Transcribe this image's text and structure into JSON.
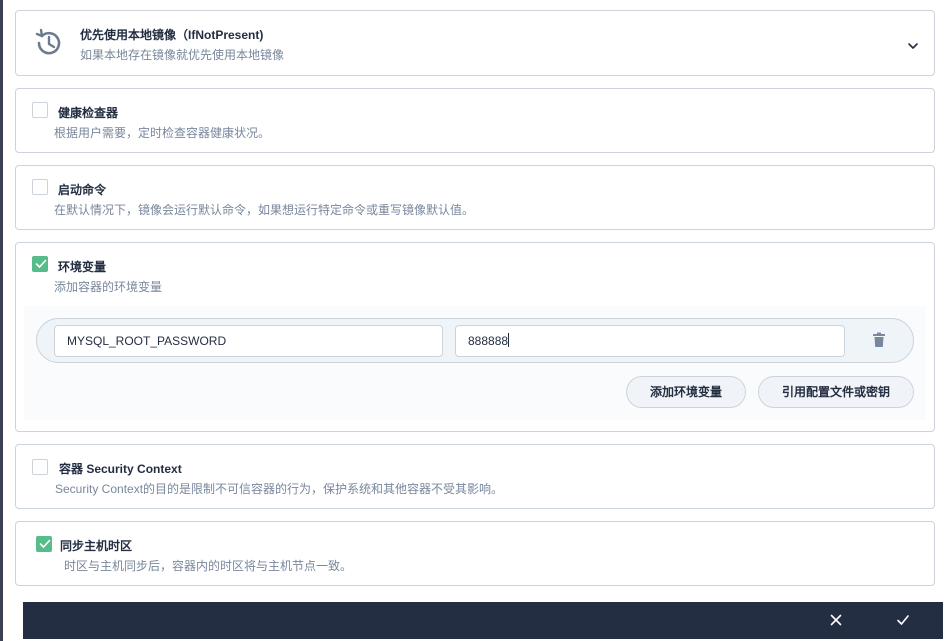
{
  "image_pull": {
    "title": "优先使用本地镜像（IfNotPresent)",
    "desc": "如果本地存在镜像就优先使用本地镜像",
    "icon": "history-icon"
  },
  "health_check": {
    "title": "健康检查器",
    "desc": "根据用户需要，定时检查容器健康状况。",
    "checked": false
  },
  "start_command": {
    "title": "启动命令",
    "desc": "在默认情况下，镜像会运行默认命令，如果想运行特定命令或重写镜像默认值。",
    "checked": false
  },
  "env_vars": {
    "title": "环境变量",
    "desc": "添加容器的环境变量",
    "checked": true,
    "rows": [
      {
        "key": "MYSQL_ROOT_PASSWORD",
        "value": "888888"
      }
    ],
    "add_button": "添加环境变量",
    "ref_button": "引用配置文件或密钥"
  },
  "security_context": {
    "title": "容器 Security Context",
    "desc": "Security Context的目的是限制不可信容器的行为，保护系统和其他容器不受其影响。",
    "checked": false
  },
  "sync_timezone": {
    "title": "同步主机时区",
    "desc": "时区与主机同步后，容器内的时区将与主机节点一致。",
    "checked": true
  },
  "colors": {
    "accent_green": "#55bc8a",
    "footer_bg": "#242e42",
    "border": "#ccd3db"
  }
}
